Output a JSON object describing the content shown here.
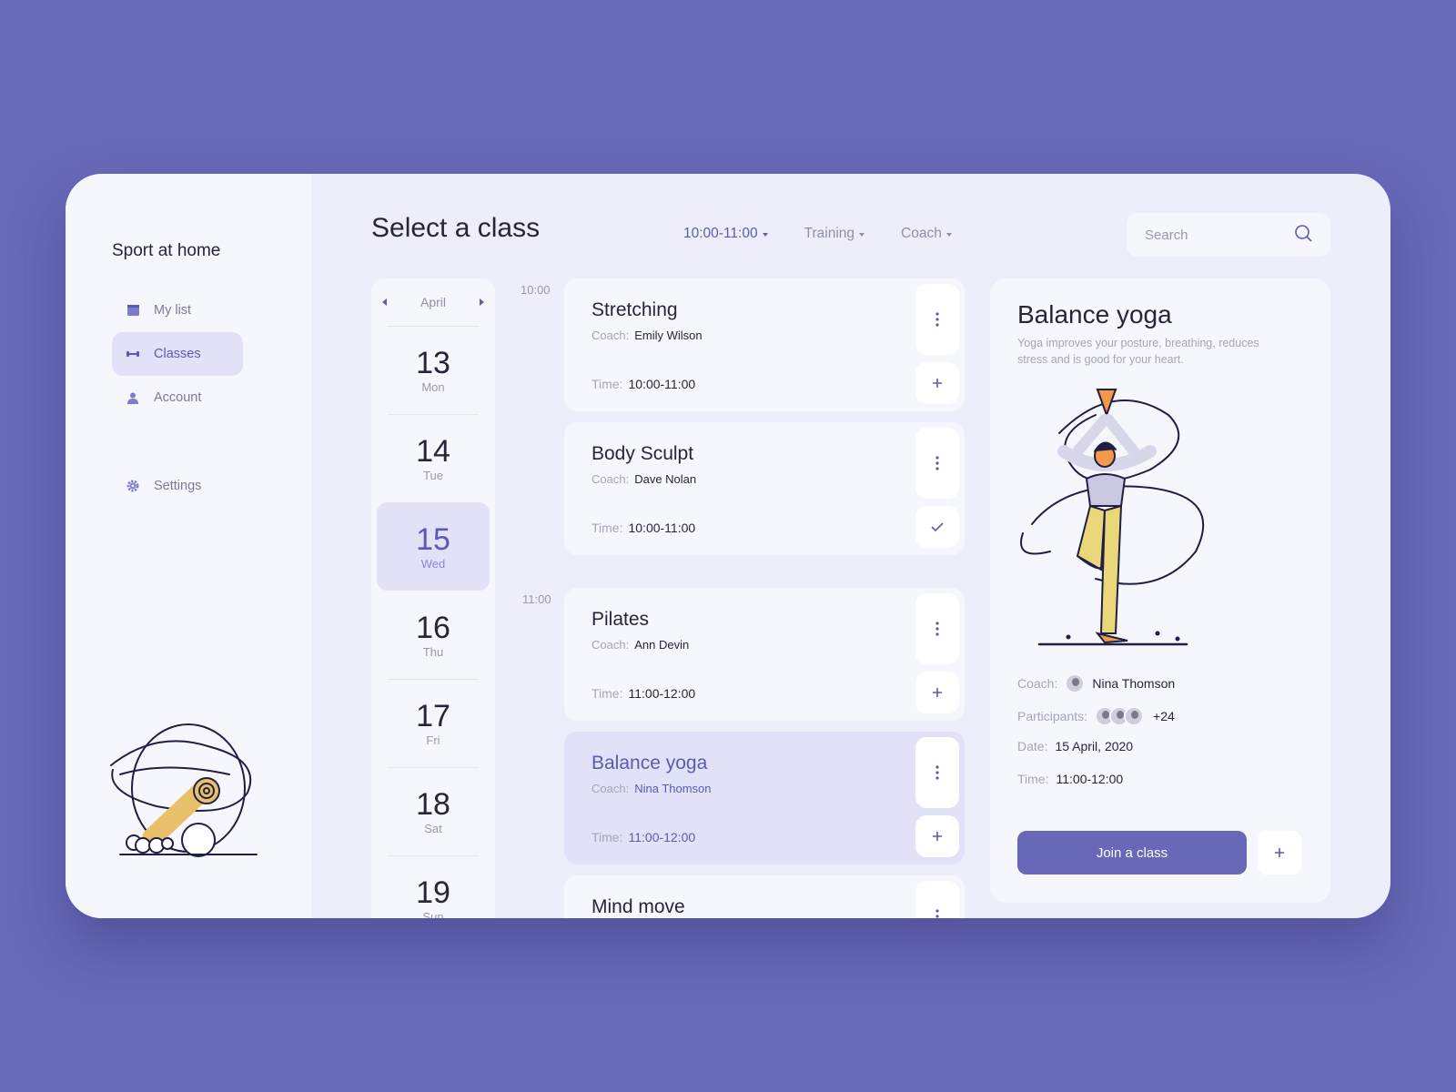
{
  "app": {
    "brand": "Sport at home",
    "title": "Select a class"
  },
  "sidebar": {
    "items": [
      {
        "label": "My list"
      },
      {
        "label": "Classes"
      },
      {
        "label": "Account"
      },
      {
        "label": "Settings"
      }
    ]
  },
  "filters": {
    "time": "10:00-11:00",
    "training": "Training",
    "coach": "Coach"
  },
  "search": {
    "placeholder": "Search"
  },
  "calendar": {
    "month": "April",
    "days": [
      {
        "num": "13",
        "wd": "Mon"
      },
      {
        "num": "14",
        "wd": "Tue"
      },
      {
        "num": "15",
        "wd": "Wed"
      },
      {
        "num": "16",
        "wd": "Thu"
      },
      {
        "num": "17",
        "wd": "Fri"
      },
      {
        "num": "18",
        "wd": "Sat"
      },
      {
        "num": "19",
        "wd": "Sun"
      }
    ]
  },
  "timeline": {
    "t1": "10:00",
    "t2": "11:00"
  },
  "labels": {
    "coach": "Coach:",
    "time": "Time:",
    "participants": "Participants:",
    "date": "Date:"
  },
  "classes": [
    {
      "name": "Stretching",
      "coach": "Emily Wilson",
      "time": "10:00-11:00"
    },
    {
      "name": "Body Sculpt",
      "coach": "Dave Nolan",
      "time": "10:00-11:00"
    },
    {
      "name": "Pilates",
      "coach": "Ann Devin",
      "time": "11:00-12:00"
    },
    {
      "name": "Balance yoga",
      "coach": "Nina Thomson",
      "time": "11:00-12:00"
    },
    {
      "name": "Mind move",
      "coach": "",
      "time": ""
    }
  ],
  "detail": {
    "title": "Balance yoga",
    "description": "Yoga improves your posture, breathing, reduces stress and is good for your heart.",
    "coach": "Nina Thomson",
    "participants_extra": "+24",
    "date": "15 April, 2020",
    "time": "11:00-12:00",
    "join_label": "Join a class"
  },
  "colors": {
    "accent": "#5a5bb0",
    "background": "#6869b8",
    "panel": "#f6f6fd",
    "highlight": "#e1e1f8"
  }
}
